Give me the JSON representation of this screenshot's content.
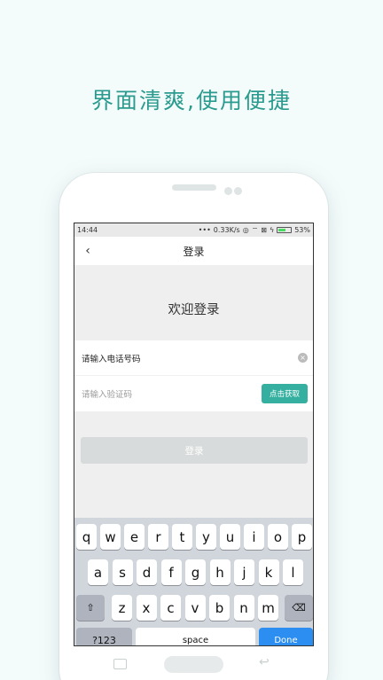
{
  "headline": "界面清爽,使用便捷",
  "status_bar": {
    "time": "14:44",
    "signal_dots": "•••",
    "speed": "0.33K/s",
    "alarm_glyph": "◎",
    "wifi_glyph": "⌔",
    "sim_glyph": "⊠",
    "charge_glyph": "ϟ",
    "battery_percent": 0.53,
    "battery_label": "53%"
  },
  "nav": {
    "back_glyph": "‹",
    "title": "登录"
  },
  "welcome": "欢迎登录",
  "phone_field": {
    "value": "请输入电话号码",
    "clear_glyph": "×"
  },
  "code_field": {
    "placeholder": "请输入验证码",
    "get_code_label": "点击获取"
  },
  "login_button": "登录",
  "keyboard": {
    "row1": [
      "q",
      "w",
      "e",
      "r",
      "t",
      "y",
      "u",
      "i",
      "o",
      "p"
    ],
    "row2": [
      "a",
      "s",
      "d",
      "f",
      "g",
      "h",
      "j",
      "k",
      "l"
    ],
    "row3": [
      "z",
      "x",
      "c",
      "v",
      "b",
      "n",
      "m"
    ],
    "shift_glyph": "⇧",
    "delete_glyph": "⌫",
    "numbers_label": "?123",
    "space_label": "space",
    "done_label": "Done"
  },
  "softkeys": {
    "back_glyph": "↩"
  },
  "colors": {
    "accent": "#2a9b8e",
    "button": "#35b0a0",
    "done": "#2b8ef0"
  }
}
